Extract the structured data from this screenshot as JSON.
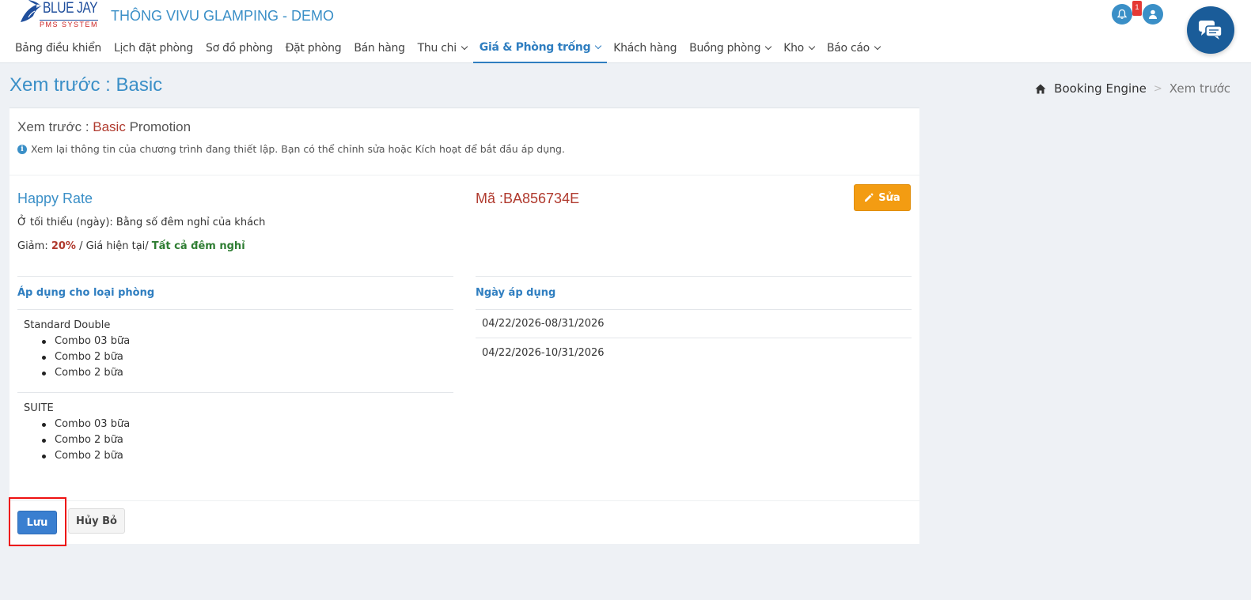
{
  "brand": {
    "logo_title": "BLUE JAY",
    "logo_sub": "PMS SYSTEM",
    "hotel_name": "THÔNG VIVU GLAMPING - DEMO"
  },
  "header": {
    "notification_count": "1",
    "icons": [
      "bell-icon",
      "user-icon",
      "chat-icon"
    ]
  },
  "nav": {
    "items": [
      {
        "label": "Bảng điều khiển"
      },
      {
        "label": "Lịch đặt phòng"
      },
      {
        "label": "Sơ đồ phòng"
      },
      {
        "label": "Đặt phòng"
      },
      {
        "label": "Bán hàng"
      },
      {
        "label": "Thu chi"
      },
      {
        "label": "Giá & Phòng trống"
      },
      {
        "label": "Khách hàng"
      },
      {
        "label": "Buồng phòng"
      },
      {
        "label": "Kho"
      },
      {
        "label": "Báo cáo"
      }
    ],
    "active": "Giá & Phòng trống"
  },
  "page": {
    "title": "Xem trước : Basic"
  },
  "breadcrumb": {
    "link": "Booking Engine",
    "separator": ">",
    "current": "Xem trước"
  },
  "card": {
    "title_prefix": "Xem trước : ",
    "title_highlight": "Basic",
    "title_suffix": " Promotion",
    "note": "Xem lại thông tin của chương trình đang thiết lập. Bạn có thể chỉnh sửa hoặc Kích hoạt để bắt đầu áp dụng.",
    "promo_name": "Happy Rate",
    "min_stay": "Ở tối thiểu (ngày): Bằng số đêm nghỉ của khách",
    "discount_label": "Giảm: ",
    "discount_value": "20%",
    "discount_mid": " / Giá hiện tại/ ",
    "discount_scope": "Tất cả đêm nghỉ",
    "code": "Mã :BA856734E",
    "edit_label": "Sửa",
    "rooms_header": "Áp dụng cho loại phòng",
    "dates_header": "Ngày áp dụng",
    "rooms": [
      {
        "name": "Standard Double",
        "rates": [
          "Combo 03 bữa",
          "Combo 2 bữa",
          "Combo 2 bữa"
        ]
      },
      {
        "name": "SUITE",
        "rates": [
          "Combo 03 bữa",
          "Combo 2 bữa",
          "Combo 2 bữa"
        ]
      }
    ],
    "dates": [
      "04/22/2026-08/31/2026",
      "04/22/2026-10/31/2026"
    ],
    "save_label": "Lưu",
    "cancel_label": "Hủy Bỏ"
  },
  "colors": {
    "accent": "#3a8fc7",
    "brand_dark": "#1a5c99",
    "danger": "#b03a2e",
    "warning": "#f39c12",
    "primary_button": "#3a7fd0",
    "success_text": "#2e7d32",
    "highlight_box": "#e11111"
  }
}
